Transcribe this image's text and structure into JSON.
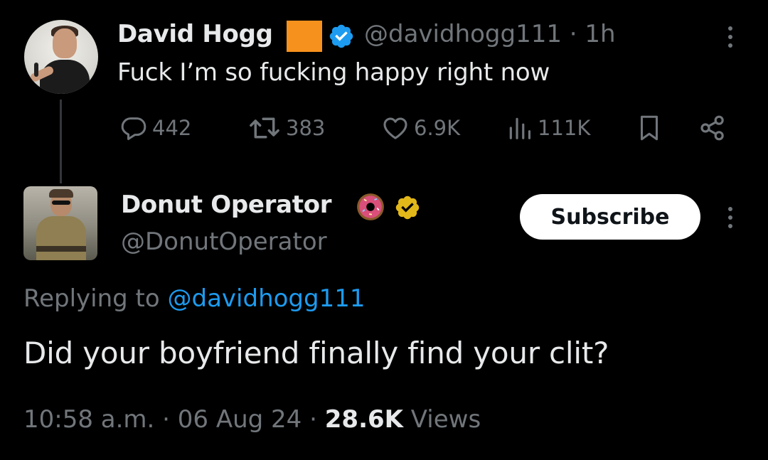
{
  "parent_tweet": {
    "author_name": "David Hogg",
    "handle": "@davidhogg111",
    "separator": "·",
    "time": "1h",
    "text": "Fuck I’m so fucking happy right now",
    "flag_color": "#f7911d",
    "verified_color": "#1d9bf0",
    "actions": {
      "reply_count": "442",
      "repost_count": "383",
      "like_count": "6.9K",
      "view_count": "111K"
    }
  },
  "reply_tweet": {
    "author_name": "Donut Operator",
    "handle": "@DonutOperator",
    "verified_color": "#e2b719",
    "subscribe_label": "Subscribe",
    "replying_prefix": "Replying to",
    "replying_mention": "@davidhogg111",
    "text": "Did your boyfriend finally find your clit?",
    "timestamp": "10:58 a.m. · 06 Aug 24 ·",
    "views_count": "28.6K",
    "views_label": "Views"
  },
  "icons": [
    "more-icon",
    "verified-blue-icon",
    "verified-gold-icon",
    "donut-icon",
    "reply-icon",
    "repost-icon",
    "like-icon",
    "views-icon",
    "bookmark-icon",
    "share-icon"
  ],
  "colors": {
    "background": "#000000",
    "text_primary": "#e7e9ea",
    "text_secondary": "#71767b",
    "link": "#1d9bf0"
  }
}
